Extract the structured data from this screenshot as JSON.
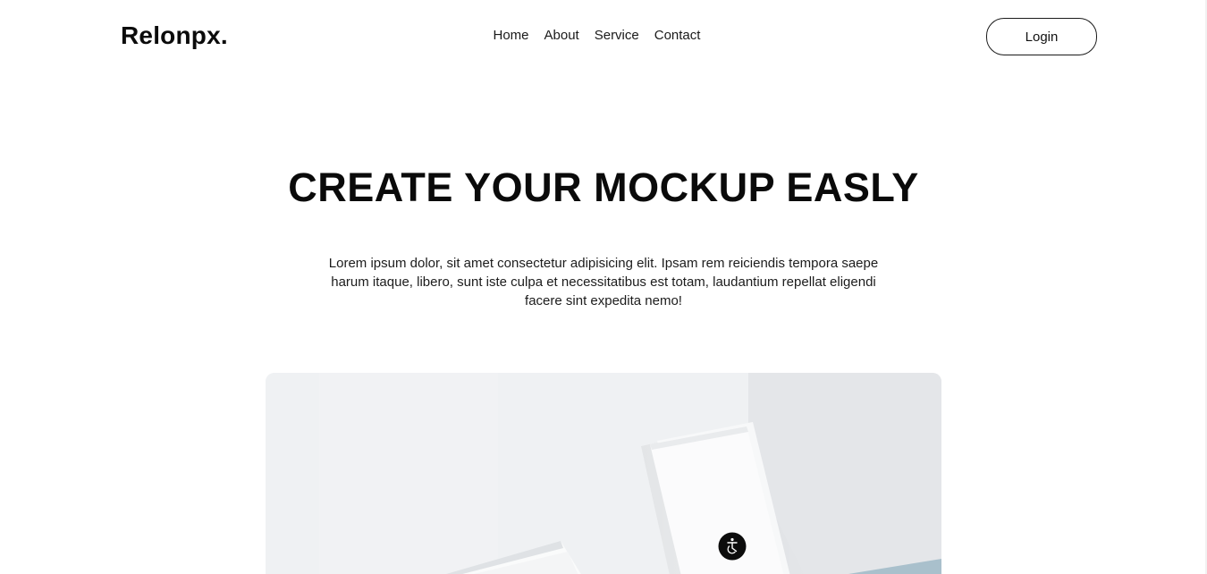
{
  "brand": {
    "logo": "Relonpx."
  },
  "nav": {
    "items": [
      "Home",
      "About",
      "Service",
      "Contact"
    ]
  },
  "header": {
    "login_label": "Login"
  },
  "hero": {
    "title": "CREATE YOUR MOCKUP EASLY",
    "description": "Lorem ipsum dolor, sit amet consectetur adipisicing elit. Ipsam rem reiciendis tempora saepe harum itaque, libero, sunt iste culpa et necessitatibus est totam, laudantium repellat eligendi facere sint expedita nemo!"
  },
  "mockup": {
    "badge_icon": "accessibility-icon"
  },
  "colors": {
    "background": "#ffffff",
    "text": "#0a0a0a",
    "mockup_bg": "#eef0f2",
    "accent_blue": "#a9c0cc"
  }
}
